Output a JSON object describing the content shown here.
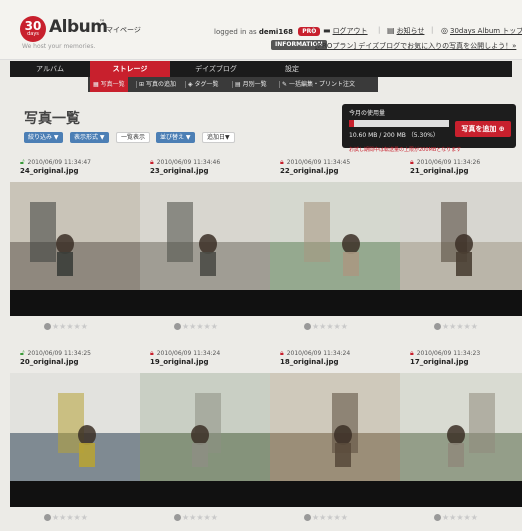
{
  "header": {
    "logo_number": "30",
    "logo_days": "days",
    "logo_word": "Album",
    "logo_tm": "™",
    "logo_mypage": "マイページ",
    "tagline": "We host your memories.",
    "logged_in_prefix": "logged in as",
    "username": "demi168",
    "pro_badge": "PRO",
    "logout": "ログアウト",
    "news": "お知らせ",
    "top_link": "30days Album トップ",
    "info_badge": "INFORMATION",
    "info_text": "[PROプラン] デイズブログでお気に入りの写真を公開しよう！»"
  },
  "nav": {
    "items": [
      "アルバム",
      "ストレージ",
      "デイズブログ",
      "設定"
    ],
    "active_index": 1
  },
  "subnav": {
    "items": [
      "写真一覧",
      "写真の追加",
      "タグ一覧",
      "月別一覧",
      "一括編集・プリント注文"
    ]
  },
  "page": {
    "title": "写真一覧",
    "controls": {
      "filter": "絞り込み ▼",
      "display_format": "表示形式 ▼",
      "list_view": "一覧表示",
      "sort": "並び替え ▼",
      "added_date": "追加日▼"
    }
  },
  "usage": {
    "label": "今月の使用量",
    "used": "10.60 MB",
    "limit": "200 MB",
    "percent": "5.30%",
    "percent_value": 5.3,
    "used_text": "10.60 MB / 200 MB （5.30%）",
    "add_button": "写真を追加 ⊕",
    "note": "お試し期間中は転送量の上限が200MBとなります"
  },
  "photos": [
    {
      "date": "2010/06/09 11:34:47",
      "name": "24_original.jpg",
      "locked": false
    },
    {
      "date": "2010/06/09 11:34:46",
      "name": "23_original.jpg",
      "locked": true
    },
    {
      "date": "2010/06/09 11:34:45",
      "name": "22_original.jpg",
      "locked": true
    },
    {
      "date": "2010/06/09 11:34:26",
      "name": "21_original.jpg",
      "locked": true
    },
    {
      "date": "2010/06/09 11:34:25",
      "name": "20_original.jpg",
      "locked": false
    },
    {
      "date": "2010/06/09 11:34:24",
      "name": "19_original.jpg",
      "locked": true
    },
    {
      "date": "2010/06/09 11:34:24",
      "name": "18_original.jpg",
      "locked": true
    },
    {
      "date": "2010/06/09 11:34:23",
      "name": "17_original.jpg",
      "locked": true
    }
  ],
  "stars_text": "★★★★★",
  "colors": {
    "accent": "#c8202d",
    "control_blue": "#4c7fb5",
    "nav_bg": "#1b1b1b"
  }
}
